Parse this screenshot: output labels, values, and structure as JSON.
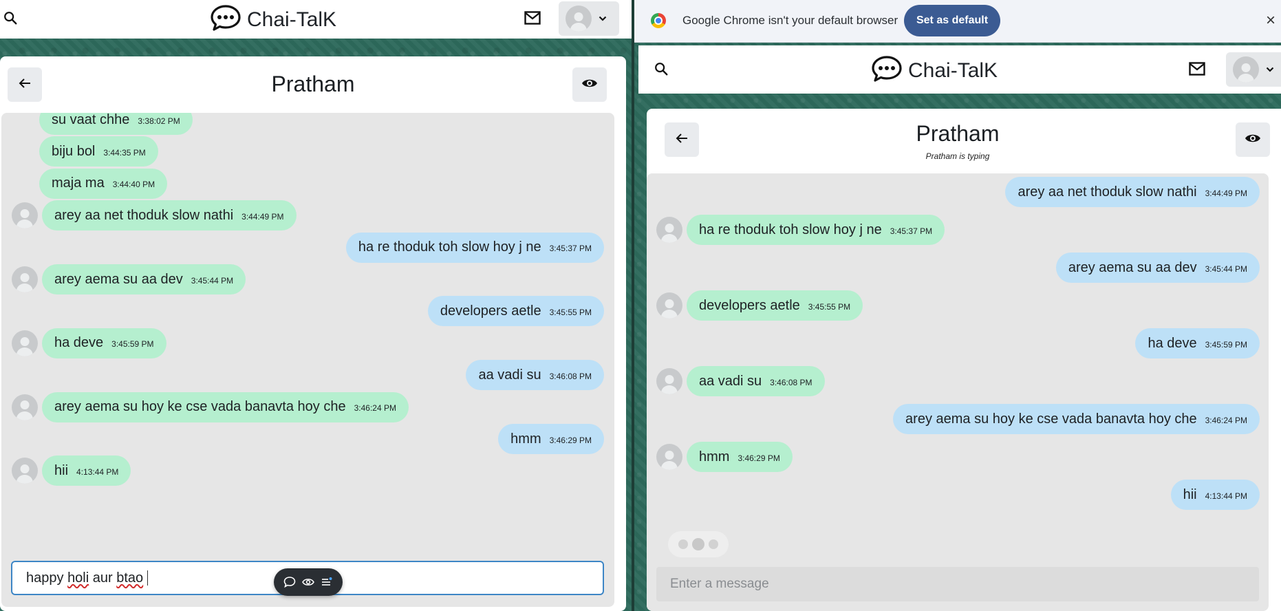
{
  "app": {
    "name": "Chai-TalK"
  },
  "left": {
    "chat_title": "Pratham",
    "composer_value_parts": [
      "happy ",
      "holi",
      " aur ",
      "btao"
    ],
    "messages": [
      {
        "text": "su vaat chhe",
        "time": "3:38:02 PM",
        "dir": "recv",
        "avatar": false
      },
      {
        "text": "biju bol",
        "time": "3:44:35 PM",
        "dir": "recv",
        "avatar": false
      },
      {
        "text": "maja ma",
        "time": "3:44:40 PM",
        "dir": "recv",
        "avatar": false
      },
      {
        "text": "arey aa net thoduk slow nathi",
        "time": "3:44:49 PM",
        "dir": "recv",
        "avatar": true
      },
      {
        "text": "ha re thoduk toh slow hoy j ne",
        "time": "3:45:37 PM",
        "dir": "sent"
      },
      {
        "text": "arey aema su aa dev",
        "time": "3:45:44 PM",
        "dir": "recv",
        "avatar": true
      },
      {
        "text": "developers aetle",
        "time": "3:45:55 PM",
        "dir": "sent"
      },
      {
        "text": "ha deve",
        "time": "3:45:59 PM",
        "dir": "recv",
        "avatar": true
      },
      {
        "text": "aa vadi su",
        "time": "3:46:08 PM",
        "dir": "sent"
      },
      {
        "text": "arey aema su hoy ke cse vada banavta hoy che",
        "time": "3:46:24 PM",
        "dir": "recv",
        "avatar": true
      },
      {
        "text": "hmm",
        "time": "3:46:29 PM",
        "dir": "sent"
      },
      {
        "text": "hii",
        "time": "4:13:44 PM",
        "dir": "recv",
        "avatar": true
      }
    ]
  },
  "right": {
    "chrome_notice": "Google Chrome isn't your default browser",
    "set_default_label": "Set as default",
    "close_glyph": "×",
    "chat_title": "Pratham",
    "typing_status": "Pratham is typing",
    "composer_placeholder": "Enter a message",
    "messages": [
      {
        "text": "arey aa net thoduk slow nathi",
        "time": "3:44:49 PM",
        "dir": "sent"
      },
      {
        "text": "ha re thoduk toh slow hoy j ne",
        "time": "3:45:37 PM",
        "dir": "recv",
        "avatar": true
      },
      {
        "text": "arey aema su aa dev",
        "time": "3:45:44 PM",
        "dir": "sent"
      },
      {
        "text": "developers aetle",
        "time": "3:45:55 PM",
        "dir": "recv",
        "avatar": true
      },
      {
        "text": "ha deve",
        "time": "3:45:59 PM",
        "dir": "sent"
      },
      {
        "text": "aa vadi su",
        "time": "3:46:08 PM",
        "dir": "recv",
        "avatar": true
      },
      {
        "text": "arey aema su hoy ke cse vada banavta hoy che",
        "time": "3:46:24 PM",
        "dir": "sent"
      },
      {
        "text": "hmm",
        "time": "3:46:29 PM",
        "dir": "recv",
        "avatar": true
      },
      {
        "text": "hii",
        "time": "4:13:44 PM",
        "dir": "sent"
      }
    ]
  },
  "icons": {
    "search": "search-icon",
    "logo": "chat-bubble-logo-icon",
    "mail": "mail-icon",
    "avatar": "user-avatar-icon",
    "chevron": "chevron-down-icon",
    "back": "arrow-left-icon",
    "eye": "eye-icon",
    "chrome": "chrome-logo-icon",
    "close": "close-icon",
    "toolbar": [
      "speech-bubble-icon",
      "eye-outline-icon",
      "list-sparkle-icon"
    ]
  },
  "colors": {
    "received_bubble": "#b5efcf",
    "sent_bubble": "#bde0f7",
    "chrome_button": "#3b5b93",
    "composer_focus": "#3d86c6"
  }
}
